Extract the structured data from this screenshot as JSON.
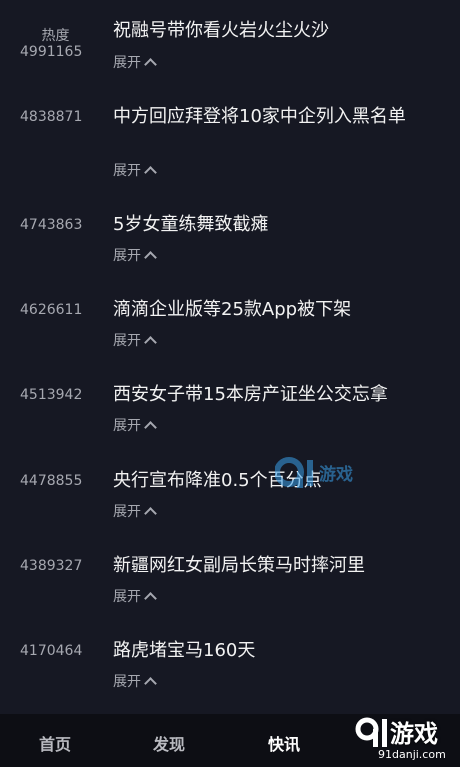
{
  "header": {
    "heat_label": "热度"
  },
  "items": [
    {
      "score": "4991165",
      "title": "祝融号带你看火岩火尘火沙",
      "expand": "展开"
    },
    {
      "score": "4838871",
      "title": "中方回应拜登将10家中企列入黑名单",
      "expand": "展开"
    },
    {
      "score": "4743863",
      "title": "5岁女童练舞致截瘫",
      "expand": "展开"
    },
    {
      "score": "4626611",
      "title": "滴滴企业版等25款App被下架",
      "expand": "展开"
    },
    {
      "score": "4513942",
      "title": "西安女子带15本房产证坐公交忘拿",
      "expand": "展开"
    },
    {
      "score": "4478855",
      "title": "央行宣布降准0.5个百分点",
      "expand": "展开"
    },
    {
      "score": "4389327",
      "title": "新疆网红女副局长策马时摔河里",
      "expand": "展开"
    },
    {
      "score": "4170464",
      "title": "路虎堵宝马160天",
      "expand": "展开"
    }
  ],
  "tabbar": {
    "tabs": [
      {
        "label": "首页"
      },
      {
        "label": "发现"
      },
      {
        "label": "快讯"
      }
    ]
  },
  "watermark": {
    "center_logo_text": "游戏",
    "brand_text": "游戏",
    "brand_sub": "91danji.com"
  },
  "colors": {
    "background": "#161823",
    "tabbar": "#0d0e14",
    "text_primary": "#f2f2f2",
    "text_secondary": "#a6a8b0",
    "watermark_blue": "#3aa0e8"
  }
}
